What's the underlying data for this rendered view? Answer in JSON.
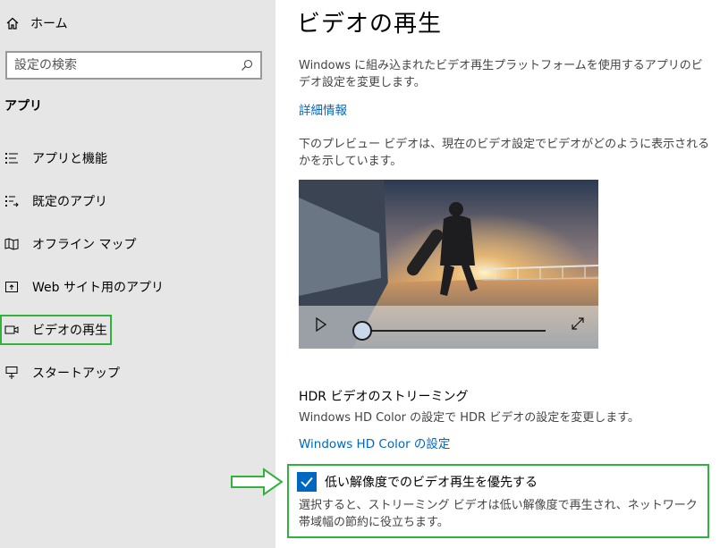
{
  "sidebar": {
    "home_label": "ホーム",
    "search_placeholder": "設定の検索",
    "section_title": "アプリ",
    "items": [
      {
        "label": "アプリと機能",
        "icon": "apps-list-icon"
      },
      {
        "label": "既定のアプリ",
        "icon": "default-apps-icon"
      },
      {
        "label": "オフライン マップ",
        "icon": "offline-map-icon"
      },
      {
        "label": "Web サイト用のアプリ",
        "icon": "website-app-icon"
      },
      {
        "label": "ビデオの再生",
        "icon": "video-icon",
        "active": true
      },
      {
        "label": "スタートアップ",
        "icon": "startup-icon"
      }
    ]
  },
  "main": {
    "title": "ビデオの再生",
    "intro": "Windows に組み込まれたビデオ再生プラットフォームを使用するアプリのビデオ設定を変更します。",
    "more_info_link": "詳細情報",
    "preview_desc": "下のプレビュー ビデオは、現在のビデオ設定でビデオがどのように表示されるかを示しています。",
    "video": {
      "progress": 0.0
    },
    "hdr": {
      "title": "HDR ビデオのストリーミング",
      "desc": "Windows HD Color の設定で HDR ビデオの設定を変更します。",
      "link": "Windows HD Color の設定"
    },
    "low_res": {
      "label": "低い解像度でのビデオ再生を優先する",
      "checked": true,
      "desc": "選択すると、ストリーミング ビデオは低い解像度で再生され、ネットワーク帯域幅の節約に役立ちます。"
    }
  },
  "colors": {
    "accent": "#0067c0",
    "highlight": "#2fb33c",
    "sidebar_bg": "#e6e6e6"
  }
}
